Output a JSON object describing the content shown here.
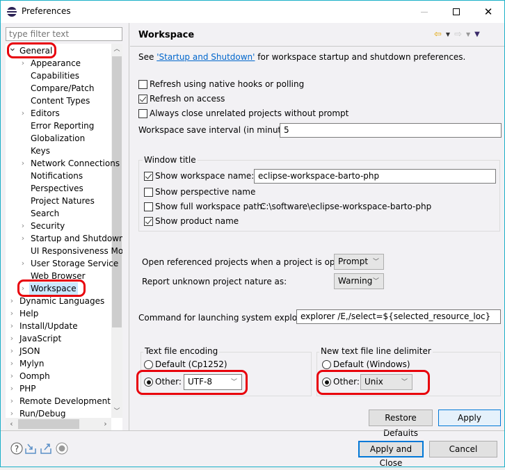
{
  "window": {
    "title": "Preferences",
    "controls": [
      "minimize",
      "maximize",
      "close"
    ]
  },
  "sidebar": {
    "filter_placeholder": "type filter text",
    "tree": [
      {
        "label": "General",
        "level": 0,
        "expanded": true,
        "has_children": true,
        "highlighted": true
      },
      {
        "label": "Appearance",
        "level": 1,
        "has_children": true
      },
      {
        "label": "Capabilities",
        "level": 1,
        "has_children": false
      },
      {
        "label": "Compare/Patch",
        "level": 1,
        "has_children": false
      },
      {
        "label": "Content Types",
        "level": 1,
        "has_children": false
      },
      {
        "label": "Editors",
        "level": 1,
        "has_children": true
      },
      {
        "label": "Error Reporting",
        "level": 1,
        "has_children": false
      },
      {
        "label": "Globalization",
        "level": 1,
        "has_children": false
      },
      {
        "label": "Keys",
        "level": 1,
        "has_children": false
      },
      {
        "label": "Network Connections",
        "level": 1,
        "has_children": true
      },
      {
        "label": "Notifications",
        "level": 1,
        "has_children": false
      },
      {
        "label": "Perspectives",
        "level": 1,
        "has_children": false
      },
      {
        "label": "Project Natures",
        "level": 1,
        "has_children": false
      },
      {
        "label": "Search",
        "level": 1,
        "has_children": false
      },
      {
        "label": "Security",
        "level": 1,
        "has_children": true
      },
      {
        "label": "Startup and Shutdown",
        "level": 1,
        "has_children": true
      },
      {
        "label": "UI Responsiveness Monitoring",
        "level": 1,
        "has_children": false
      },
      {
        "label": "User Storage Service",
        "level": 1,
        "has_children": true
      },
      {
        "label": "Web Browser",
        "level": 1,
        "has_children": false
      },
      {
        "label": "Workspace",
        "level": 1,
        "has_children": true,
        "selected": true,
        "highlighted": true
      },
      {
        "label": "Dynamic Languages",
        "level": 0,
        "has_children": true
      },
      {
        "label": "Help",
        "level": 0,
        "has_children": true
      },
      {
        "label": "Install/Update",
        "level": 0,
        "has_children": true
      },
      {
        "label": "JavaScript",
        "level": 0,
        "has_children": true
      },
      {
        "label": "JSON",
        "level": 0,
        "has_children": true
      },
      {
        "label": "Mylyn",
        "level": 0,
        "has_children": true
      },
      {
        "label": "Oomph",
        "level": 0,
        "has_children": true
      },
      {
        "label": "PHP",
        "level": 0,
        "has_children": true
      },
      {
        "label": "Remote Development",
        "level": 0,
        "has_children": true
      },
      {
        "label": "Run/Debug",
        "level": 0,
        "has_children": true
      }
    ]
  },
  "page": {
    "title": "Workspace",
    "intro_prefix": "See ",
    "intro_link": "'Startup and Shutdown'",
    "intro_suffix": " for workspace startup and shutdown preferences.",
    "checkboxes": [
      {
        "label": "Refresh using native hooks or polling",
        "checked": false
      },
      {
        "label": "Refresh on access",
        "checked": true
      },
      {
        "label": "Always close unrelated projects without prompt",
        "checked": false
      }
    ],
    "save_interval_label": "Workspace save interval (in minutes):",
    "save_interval_value": "5",
    "window_title_group": {
      "label": "Window title",
      "show_workspace_name": {
        "label": "Show workspace name:",
        "checked": true,
        "value": "eclipse-workspace-barto-php"
      },
      "show_perspective_name": {
        "label": "Show perspective name",
        "checked": false
      },
      "show_full_path": {
        "label": "Show full workspace path:",
        "checked": false,
        "value": "C:\\software\\eclipse-workspace-barto-php"
      },
      "show_product_name": {
        "label": "Show product name",
        "checked": true
      }
    },
    "open_referenced_label": "Open referenced projects when a project is opened:",
    "open_referenced_value": "Prompt",
    "report_unknown_label": "Report unknown project nature as:",
    "report_unknown_value": "Warning",
    "explorer_label": "Command for launching system explorer:",
    "explorer_value": "explorer /E,/select=${selected_resource_loc}",
    "encoding_group": {
      "label": "Text file encoding",
      "default_label": "Default (Cp1252)",
      "default_checked": false,
      "other_label": "Other:",
      "other_checked": true,
      "other_value": "UTF-8"
    },
    "delimiter_group": {
      "label": "New text file line delimiter",
      "default_label": "Default (Windows)",
      "default_checked": false,
      "other_label": "Other:",
      "other_checked": true,
      "other_value": "Unix"
    },
    "restore_defaults_label": "Restore Defaults",
    "apply_label": "Apply"
  },
  "footer": {
    "icons": [
      "help-icon",
      "import-icon",
      "export-icon",
      "record-icon"
    ],
    "apply_close_label": "Apply and Close",
    "cancel_label": "Cancel"
  },
  "colors": {
    "highlight": "#e8000b",
    "link": "#0066cc",
    "selection": "#cce8ff",
    "window_border": "#1ab0c8",
    "default_button_border": "#0078d7"
  }
}
